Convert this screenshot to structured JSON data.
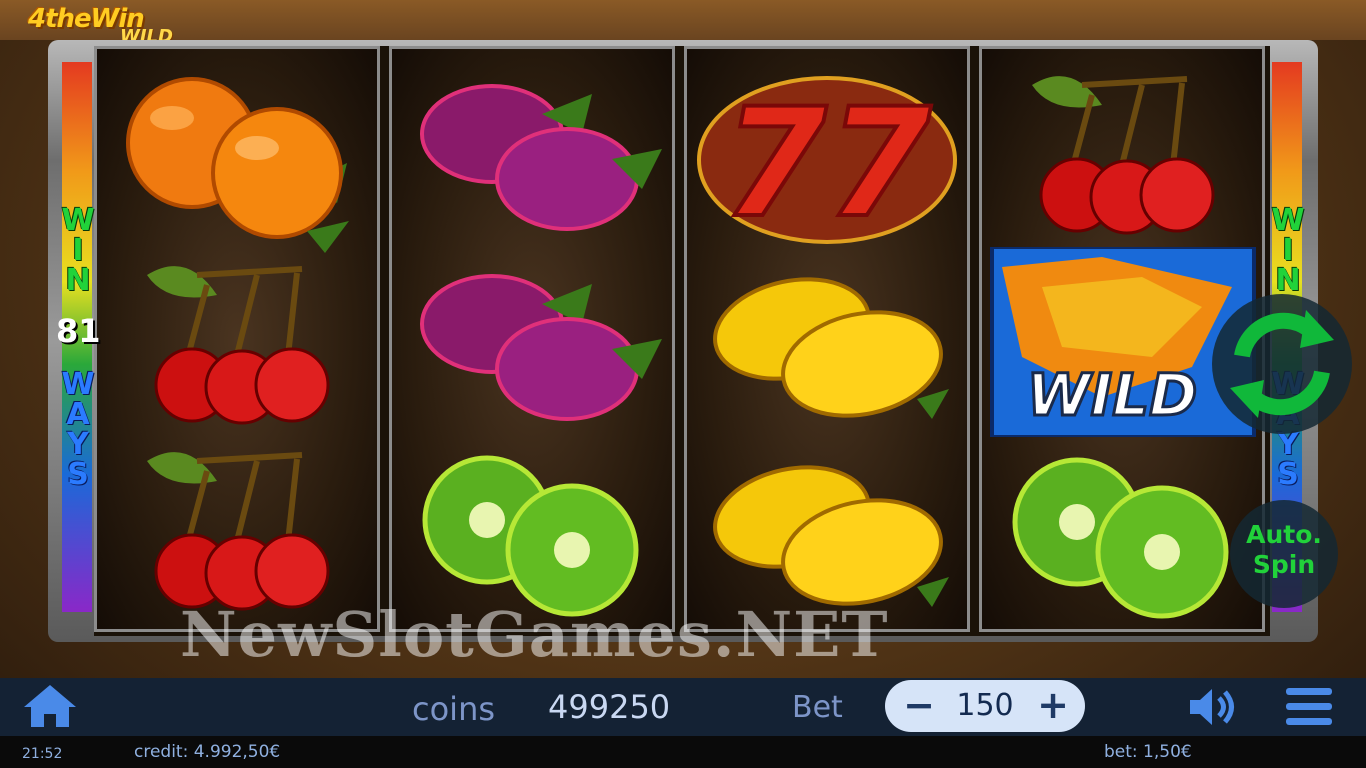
{
  "game": {
    "logo_line1": "4theWin",
    "logo_line2": "WILD"
  },
  "side_panel": {
    "win_letters": [
      "W",
      "I",
      "N"
    ],
    "ways_count": "81",
    "ways_letters": [
      "W",
      "A",
      "Y",
      "S"
    ]
  },
  "reels": [
    [
      "orange-icon",
      "cherry-icon",
      "cherry-icon"
    ],
    [
      "plum-icon",
      "plum-icon",
      "kiwi-icon"
    ],
    [
      "seven-icon",
      "lemon-icon",
      "lemon-icon"
    ],
    [
      "cherry-icon",
      "wild-fox-icon",
      "kiwi-icon"
    ]
  ],
  "wild_text": "WILD",
  "seven_text": "77",
  "auto_spin": {
    "line1": "Auto.",
    "line2": "Spin"
  },
  "watermark": "NewSlotGames.NET",
  "bottom_bar": {
    "coins_label": "coins",
    "coins_value": "499250",
    "bet_label": "Bet",
    "bet_value": "150",
    "minus": "−",
    "plus": "+"
  },
  "status_bar": {
    "time": "21:52",
    "credit": "credit: 4.992,50€",
    "bet": "bet: 1,50€"
  },
  "colors": {
    "win_green": "#21d23a",
    "ways_blue": "#2b7bff",
    "bar_bg": "#142234"
  }
}
